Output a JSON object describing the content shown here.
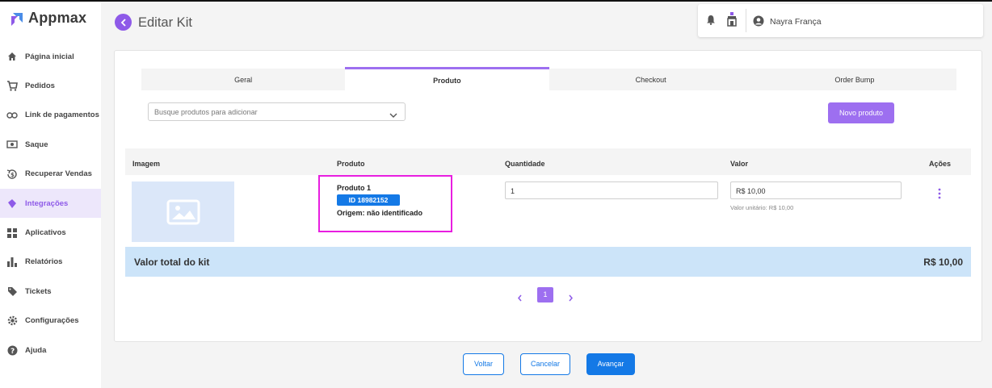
{
  "app": {
    "name": "Appmax"
  },
  "sidebar": {
    "items": [
      {
        "label": "Página inicial",
        "icon": "home-icon"
      },
      {
        "label": "Pedidos",
        "icon": "cart-icon"
      },
      {
        "label": "Link de pagamentos",
        "icon": "link-icon"
      },
      {
        "label": "Saque",
        "icon": "cash-icon"
      },
      {
        "label": "Recuperar Vendas",
        "icon": "recover-icon"
      },
      {
        "label": "Integrações",
        "icon": "puzzle-icon",
        "active": true
      },
      {
        "label": "Aplicativos",
        "icon": "apps-icon"
      },
      {
        "label": "Relatórios",
        "icon": "bar-chart-icon"
      },
      {
        "label": "Tickets",
        "icon": "ticket-icon"
      },
      {
        "label": "Configurações",
        "icon": "gear-icon"
      },
      {
        "label": "Ajuda",
        "icon": "help-icon"
      }
    ]
  },
  "header": {
    "title": "Editar Kit",
    "user": {
      "name": "Nayra França"
    }
  },
  "tabs": [
    {
      "label": "Geral"
    },
    {
      "label": "Produto",
      "active": true
    },
    {
      "label": "Checkout"
    },
    {
      "label": "Order Bump"
    }
  ],
  "search": {
    "placeholder": "Busque produtos para adicionar"
  },
  "new_product_button": "Novo produto",
  "table": {
    "headers": {
      "image": "Imagem",
      "product": "Produto",
      "quantity": "Quantidade",
      "value": "Valor",
      "actions": "Ações"
    },
    "rows": [
      {
        "product_name": "Produto 1",
        "product_id": "ID 18982152",
        "origin": "Origem: não identificado",
        "quantity": "1",
        "value": "R$ 10,00",
        "unit_value": "Valor unitário: R$ 10,00"
      }
    ]
  },
  "total": {
    "label": "Valor total do kit",
    "value": "R$ 10,00"
  },
  "pagination": {
    "current": "1",
    "prev": "‹",
    "next": "›"
  },
  "footer": {
    "back": "Voltar",
    "cancel": "Cancelar",
    "next": "Avançar"
  },
  "colors": {
    "accent": "#9d6ff0",
    "primary": "#1479e6",
    "highlight": "#e81ee0",
    "total_bg": "#cce4f9"
  }
}
